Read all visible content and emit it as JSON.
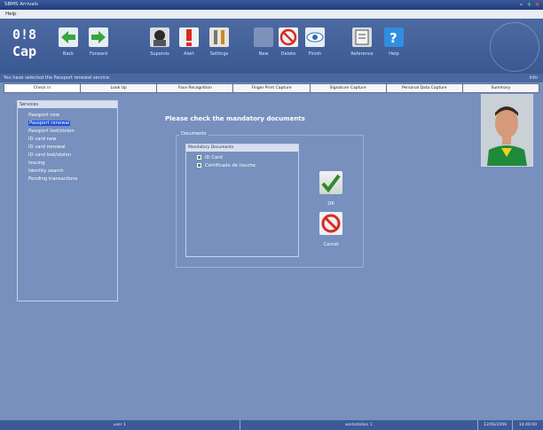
{
  "window": {
    "title": "SBMS Arrivals"
  },
  "menu": {
    "help": "Help"
  },
  "logo": "Logo",
  "toolbar": {
    "back": "Back",
    "forward": "Forward",
    "supervise": "Supervis",
    "alert": "Alert",
    "settings": "Settings",
    "new": "New",
    "delete": "Delete",
    "finish": "Finish",
    "reference": "Reference",
    "help": "Help"
  },
  "status": {
    "message": "You have selected the Passport renewal service.",
    "info": "Info"
  },
  "tabs": [
    "Check in",
    "Look Up",
    "Face Recognition",
    "Finger Print Capture",
    "Signature Capture",
    "Personal Data Capture",
    "Summary"
  ],
  "services": {
    "header": "Services",
    "items": [
      "Passport new",
      "Passport renewal",
      "Passport lost/stolen",
      "ID card new",
      "ID card renewal",
      "ID card lost/stolen",
      "Issuing",
      "Identity search",
      "Pending transactions"
    ],
    "selected_index": 1
  },
  "main": {
    "heading": "Please check the mandatory documents",
    "documents_legend": "Documents",
    "mandatory_header": "Mandatory Documents",
    "checklist": [
      "ID Card",
      "Certificado de touche"
    ],
    "ok": "OK",
    "cancel": "Cancel"
  },
  "bottom": {
    "user": "user 1",
    "workstation": "workstation 1",
    "date": "12/06/2006",
    "time": "14:49:00"
  },
  "colors": {
    "background": "#7790bd",
    "toolbar": "#3a5891",
    "selection": "#1d4fd6"
  }
}
